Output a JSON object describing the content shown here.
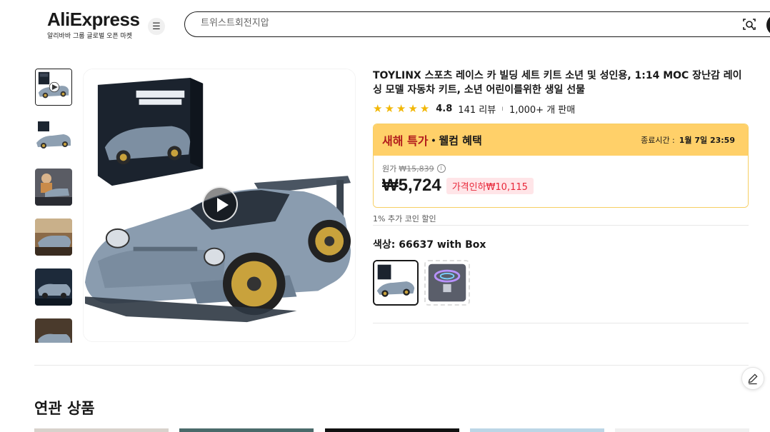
{
  "header": {
    "logo": "AliExpress",
    "logo_sub": "알리바바 그룹 글로벌 오픈 마켓",
    "menu_icon": "hamburger-menu-icon",
    "search_placeholder": "트위스트회전지압",
    "camera_icon": "camera-search-icon",
    "submit_icon": "search-submit-icon"
  },
  "gallery": {
    "thumbnail_count": 6,
    "active_index": 0,
    "main_play_icon": "play-icon"
  },
  "product": {
    "title": "TOYLINX 스포츠 레이스 카 빌딩 세트 키트 소년 및 성인용, 1:14 MOC 장난감 레이싱 모델 자동차 키트, 소년 어린이를위한 생일 선물",
    "rating": 4.8,
    "rating_text": "4.8",
    "star_count": 5,
    "reviews": "141 리뷰",
    "separator": "ı",
    "sold": "1,000+ 개 판매"
  },
  "promo": {
    "tag": "새해 특가",
    "dot": "•",
    "sub": "웰컴 혜택",
    "end_label": "종료시간 :",
    "end_time": "1월 7일 23:59",
    "original_label": "원가",
    "original_price": "₩15,839",
    "info_icon": "info-icon",
    "price": "₩5,724",
    "discount": "가격인하₩10,115",
    "accent_color": "#ffd069",
    "discount_color": "#e8283a"
  },
  "coin_text": "1% 추가 코인 할인",
  "variants": {
    "label": "색상: 66637 with Box",
    "options": [
      {
        "name": "66637 with Box",
        "selected": true
      },
      {
        "name": "light option",
        "selected": false
      }
    ]
  },
  "edit_icon": "pencil-edit-icon",
  "related": {
    "title": "연관 상품"
  }
}
